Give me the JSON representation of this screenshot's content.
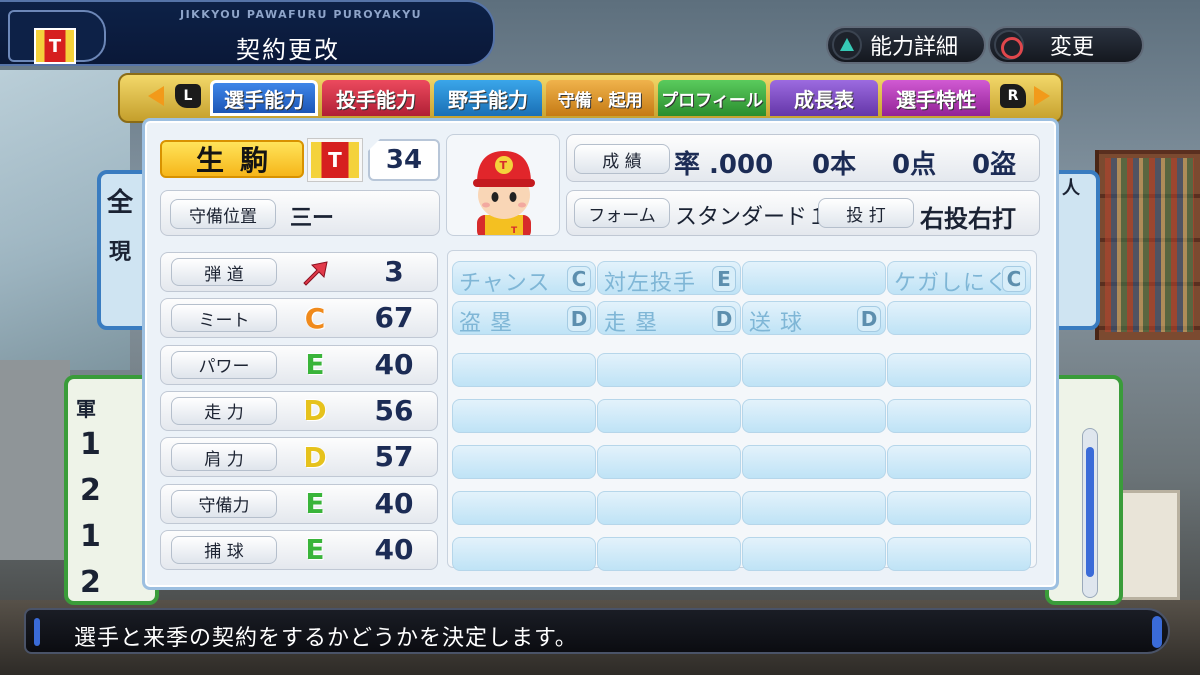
{
  "header": {
    "game_title_en": "JIKKYOU PAWAFURU PUROYAKYU",
    "screen_title": "契約更改",
    "team_logo_letter": "T"
  },
  "top_buttons": {
    "detail_label": "能力詳細",
    "change_label": "変更"
  },
  "tabs": [
    {
      "label": "選手能力",
      "active": true
    },
    {
      "label": "投手能力"
    },
    {
      "label": "野手能力"
    },
    {
      "label": "守備・起用"
    },
    {
      "label": "プロフィール"
    },
    {
      "label": "成長表"
    },
    {
      "label": "選手特性"
    }
  ],
  "shoulder_buttons": {
    "left": "L",
    "right": "R"
  },
  "player": {
    "name": "生駒",
    "team_letter": "T",
    "number": "34",
    "position_label": "守備位置",
    "position": "三ー"
  },
  "season": {
    "label": "成 績",
    "avg": "率 .000",
    "hr": "0本",
    "rbi": "0点",
    "sb": "0盗"
  },
  "form": {
    "label": "フォーム",
    "value": "スタンダード１",
    "bat_label": "投 打",
    "bat_value": "右投右打"
  },
  "abilities": [
    {
      "label": "弾 道",
      "grade": "",
      "value": "3",
      "color": "#e23a4a"
    },
    {
      "label": "ミート",
      "grade": "C",
      "value": "67",
      "color": "#f08a1c"
    },
    {
      "label": "パワー",
      "grade": "E",
      "value": "40",
      "color": "#39b43a"
    },
    {
      "label": "走 力",
      "grade": "D",
      "value": "56",
      "color": "#e6c21c"
    },
    {
      "label": "肩 力",
      "grade": "D",
      "value": "57",
      "color": "#e6c21c"
    },
    {
      "label": "守備力",
      "grade": "E",
      "value": "40",
      "color": "#39b43a"
    },
    {
      "label": "捕 球",
      "grade": "E",
      "value": "40",
      "color": "#39b43a"
    }
  ],
  "special": [
    {
      "label": "チャンス",
      "grade": "C"
    },
    {
      "label": "対左投手",
      "grade": "E"
    },
    {
      "label": "",
      "grade": ""
    },
    {
      "label": "ケガしにくさ",
      "grade": "C"
    },
    {
      "label": "盗 塁",
      "grade": "D"
    },
    {
      "label": "走 塁",
      "grade": "D"
    },
    {
      "label": "送 球",
      "grade": "D"
    },
    {
      "label": "",
      "grade": ""
    }
  ],
  "message": "選手と来季の契約をするかどうかを決定します。",
  "background_fragments": {
    "left_char": "全",
    "left_char2": "現",
    "left_army": "軍",
    "right_people": "人",
    "rank_numbers": [
      "1",
      "2",
      "1",
      "2"
    ]
  }
}
